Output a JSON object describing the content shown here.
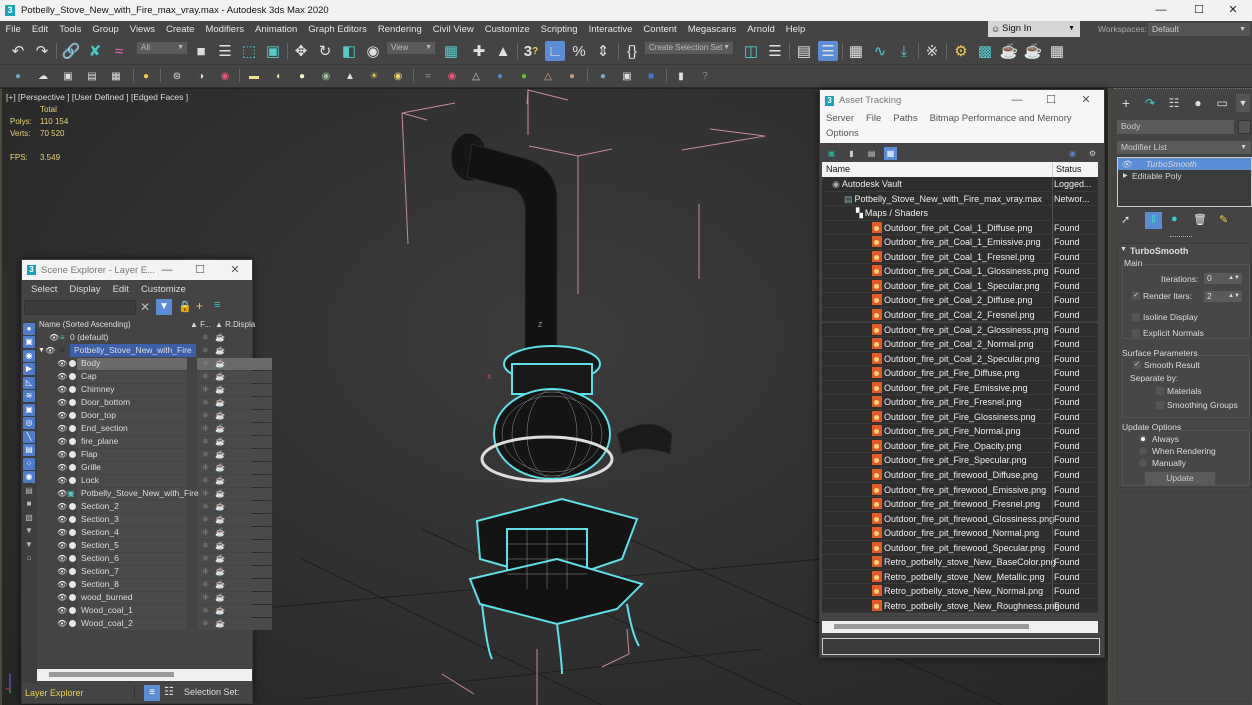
{
  "window": {
    "title": "Potbelly_Stove_New_with_Fire_max_vray.max - Autodesk 3ds Max 2020",
    "app_icon_glyph": "3",
    "controls": {
      "minimize": "—",
      "maximize": "☐",
      "close": "✕"
    }
  },
  "menubar": {
    "items": [
      "File",
      "Edit",
      "Tools",
      "Group",
      "Views",
      "Create",
      "Modifiers",
      "Animation",
      "Graph Editors",
      "Rendering",
      "Civil View",
      "Customize",
      "Scripting",
      "Interactive",
      "Content",
      "Megascans",
      "Arnold",
      "Help"
    ],
    "sign_in": "Sign In",
    "workspaces_label": "Workspaces:",
    "workspace_value": "Default"
  },
  "toolbar": {
    "selection_filter": "All",
    "reference_coord": "View",
    "named_selection": "Create Selection Set",
    "snap_3d": "3"
  },
  "viewport": {
    "label": "[+] [Perspective ] [User Defined ] [Edged Faces ]",
    "stats_header": "Total",
    "polys_label": "Polys:",
    "polys_value": "110 154",
    "verts_label": "Verts:",
    "verts_value": "70 520",
    "fps_label": "FPS:",
    "fps_value": "3.549",
    "axis_z": "Z",
    "axis_x": "X"
  },
  "scene_explorer": {
    "title": "Scene Explorer - Layer E...",
    "menu": [
      "Select",
      "Display",
      "Edit",
      "Customize"
    ],
    "search_value": "",
    "columns": {
      "name": "Name (Sorted Ascending)",
      "frozen": "▲ F...",
      "renderable": "▲ R...",
      "display": "Displa"
    },
    "layers": [
      {
        "name": "0 (default)",
        "level": 0,
        "type": "layer"
      },
      {
        "name": "Potbelly_Stove_New_with_Fire",
        "level": 0,
        "type": "layer",
        "expanded": true,
        "highlighted": true
      }
    ],
    "objects": [
      "Body",
      "Cap",
      "Chimney",
      "Door_bottom",
      "Door_top",
      "End_section",
      "fire_plane",
      "Flap",
      "Grille",
      "Lock",
      "Potbelly_Stove_New_with_Fire",
      "Section_2",
      "Section_3",
      "Section_4",
      "Section_5",
      "Section_6",
      "Section_7",
      "Section_8",
      "wood_burned",
      "Wood_coal_1",
      "Wood_coal_2"
    ],
    "selected_object": "Body",
    "footer_mode": "Layer Explorer",
    "selection_set_label": "Selection Set:"
  },
  "asset_tracking": {
    "title": "Asset Tracking",
    "menu_row1": [
      "Server",
      "File",
      "Paths",
      "Bitmap Performance and Memory"
    ],
    "menu_row2": [
      "Options"
    ],
    "columns": {
      "name": "Name",
      "status": "Status"
    },
    "tree": [
      {
        "name": "Autodesk Vault",
        "status": "Logged...",
        "level": 0,
        "icon": "vault-icon"
      },
      {
        "name": "Potbelly_Stove_New_with_Fire_max_vray.max",
        "status": "Networ...",
        "level": 1,
        "icon": "max-file-icon"
      },
      {
        "name": "Maps / Shaders",
        "status": "",
        "level": 2,
        "icon": "maps-icon"
      }
    ],
    "files": [
      {
        "name": "Outdoor_fire_pit_Coal_1_Diffuse.png",
        "status": "Found"
      },
      {
        "name": "Outdoor_fire_pit_Coal_1_Emissive.png",
        "status": "Found"
      },
      {
        "name": "Outdoor_fire_pit_Coal_1_Fresnel.png",
        "status": "Found"
      },
      {
        "name": "Outdoor_fire_pit_Coal_1_Glossiness.png",
        "status": "Found"
      },
      {
        "name": "Outdoor_fire_pit_Coal_1_Specular.png",
        "status": "Found"
      },
      {
        "name": "Outdoor_fire_pit_Coal_2_Diffuse.png",
        "status": "Found"
      },
      {
        "name": "Outdoor_fire_pit_Coal_2_Fresnel.png",
        "status": "Found"
      },
      {
        "name": "Outdoor_fire_pit_Coal_2_Glossiness.png",
        "status": "Found"
      },
      {
        "name": "Outdoor_fire_pit_Coal_2_Normal.png",
        "status": "Found"
      },
      {
        "name": "Outdoor_fire_pit_Coal_2_Specular.png",
        "status": "Found"
      },
      {
        "name": "Outdoor_fire_pit_Fire_Diffuse.png",
        "status": "Found"
      },
      {
        "name": "Outdoor_fire_pit_Fire_Emissive.png",
        "status": "Found"
      },
      {
        "name": "Outdoor_fire_pit_Fire_Fresnel.png",
        "status": "Found"
      },
      {
        "name": "Outdoor_fire_pit_Fire_Glossiness.png",
        "status": "Found"
      },
      {
        "name": "Outdoor_fire_pit_Fire_Normal.png",
        "status": "Found"
      },
      {
        "name": "Outdoor_fire_pit_Fire_Opacity.png",
        "status": "Found"
      },
      {
        "name": "Outdoor_fire_pit_Fire_Specular.png",
        "status": "Found"
      },
      {
        "name": "Outdoor_fire_pit_firewood_Diffuse.png",
        "status": "Found"
      },
      {
        "name": "Outdoor_fire_pit_firewood_Emissive.png",
        "status": "Found"
      },
      {
        "name": "Outdoor_fire_pit_firewood_Fresnel.png",
        "status": "Found"
      },
      {
        "name": "Outdoor_fire_pit_firewood_Glossiness.png",
        "status": "Found"
      },
      {
        "name": "Outdoor_fire_pit_firewood_Normal.png",
        "status": "Found"
      },
      {
        "name": "Outdoor_fire_pit_firewood_Specular.png",
        "status": "Found"
      },
      {
        "name": "Retro_potbelly_stove_New_BaseColor.png",
        "status": "Found"
      },
      {
        "name": "Retro_potbelly_stove_New_Metallic.png",
        "status": "Found"
      },
      {
        "name": "Retro_potbelly_stove_New_Normal.png",
        "status": "Found"
      },
      {
        "name": "Retro_potbelly_stove_New_Roughness.png",
        "status": "Found"
      }
    ],
    "path_field": ""
  },
  "command_panel": {
    "object_name": "Body",
    "modifier_list": "Modifier List",
    "stack": [
      {
        "name": "TurboSmooth",
        "selected": true
      },
      {
        "name": "Editable Poly",
        "selected": false
      }
    ],
    "turbosmooth": {
      "title": "TurboSmooth",
      "main_label": "Main",
      "iterations_label": "Iterations:",
      "iterations_value": "0",
      "render_iters_label": "Render Iters:",
      "render_iters_value": "2",
      "render_iters_checked": true,
      "isoline_label": "Isoline Display",
      "isoline_checked": false,
      "explicit_normals_label": "Explicit Normals",
      "explicit_normals_checked": false,
      "surface_label": "Surface Parameters",
      "smooth_result_label": "Smooth Result",
      "smooth_result_checked": true,
      "separate_by_label": "Separate by:",
      "materials_label": "Materials",
      "smoothing_groups_label": "Smoothing Groups",
      "update_options_label": "Update Options",
      "always_label": "Always",
      "when_rendering_label": "When Rendering",
      "manually_label": "Manually",
      "update_mode": "Always",
      "update_button": "Update"
    }
  },
  "colors": {
    "accent_blue": "#5b8cd6",
    "selection_cyan": "#5fe0e8",
    "stats_yellow": "#e6d27a",
    "layer_highlight": "#3d5fa8"
  }
}
